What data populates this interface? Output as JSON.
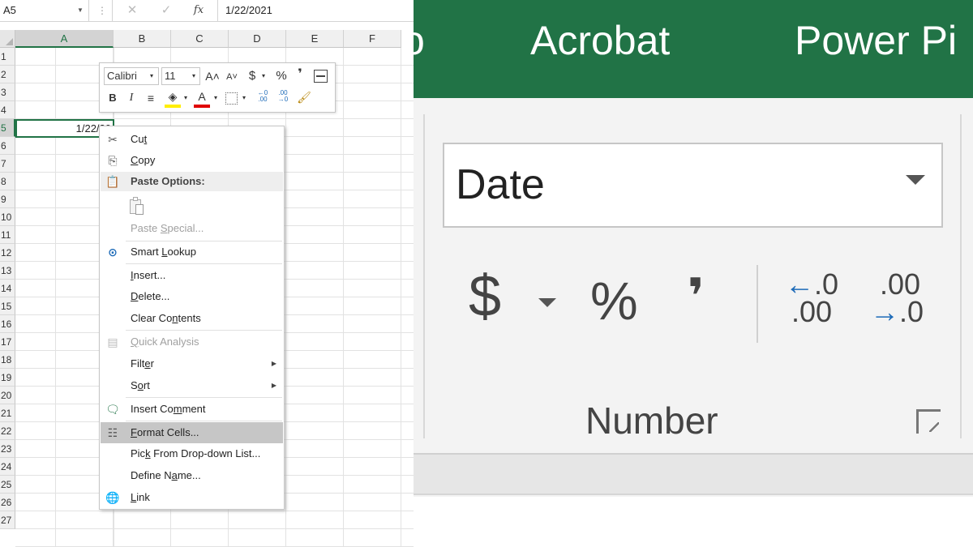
{
  "formula_bar": {
    "name_box": "A5",
    "name_box_arrow": "▼",
    "dots": "⋮",
    "cancel_icon": "✕",
    "enter_icon": "✓",
    "fx_label": "fx",
    "value": "1/22/2021"
  },
  "grid": {
    "columns": [
      "A",
      "B",
      "C",
      "D",
      "E",
      "F"
    ],
    "rows": [
      "1",
      "2",
      "3",
      "4",
      "5",
      "6",
      "7",
      "8",
      "9",
      "10",
      "11",
      "12",
      "13",
      "14",
      "15",
      "16",
      "17",
      "18",
      "19",
      "20",
      "21",
      "22",
      "23",
      "24",
      "25",
      "26",
      "27"
    ],
    "selected_column": "A",
    "selected_row": "5",
    "cell_a5": "1/22/20"
  },
  "mini_toolbar": {
    "font": "Calibri",
    "size": "11",
    "grow_font": "A˄",
    "shrink_font": "A˅",
    "dollar": "$",
    "percent": "%",
    "comma": "❜",
    "bold": "B",
    "italic": "I",
    "align": "≡",
    "fill_icon": "◈",
    "font_color": "A",
    "inc_decimal": "←0\n.00",
    "dec_decimal": ".00\n→0",
    "painter_icon": "🖌",
    "dropdown_arrow": "▾",
    "colors": {
      "fill": "#ffee00",
      "font": "#e00000"
    }
  },
  "context_menu": {
    "cut": {
      "pre": "Cu",
      "key": "t",
      "post": ""
    },
    "copy": {
      "pre": "",
      "key": "C",
      "post": "opy"
    },
    "paste_options": "Paste Options:",
    "paste_special": {
      "pre": "Paste ",
      "key": "S",
      "post": "pecial..."
    },
    "smart_lookup": {
      "pre": "Smart ",
      "key": "L",
      "post": "ookup"
    },
    "insert": {
      "pre": "",
      "key": "I",
      "post": "nsert..."
    },
    "delete": {
      "pre": "",
      "key": "D",
      "post": "elete..."
    },
    "clear_contents": {
      "pre": "Clear Co",
      "key": "n",
      "post": "tents"
    },
    "quick_analysis": {
      "pre": "",
      "key": "Q",
      "post": "uick Analysis"
    },
    "filter": {
      "pre": "Filt",
      "key": "e",
      "post": "r"
    },
    "sort": {
      "pre": "S",
      "key": "o",
      "post": "rt"
    },
    "insert_comment": {
      "pre": "Insert Co",
      "key": "m",
      "post": "ment"
    },
    "format_cells": {
      "pre": "",
      "key": "F",
      "post": "ormat Cells..."
    },
    "pick_from_list": {
      "pre": "Pic",
      "key": "k",
      "post": " From Drop-down List..."
    },
    "define_name": {
      "pre": "Define N",
      "key": "a",
      "post": "me..."
    },
    "link": {
      "pre": "",
      "key": "L",
      "post": "ink"
    },
    "submenu_arrow": "▶"
  },
  "ribbon": {
    "tabs": {
      "partial": "o",
      "acrobat": "Acrobat",
      "power_pivot": "Power Pi"
    },
    "number_format": "Date",
    "currency": "$",
    "percent": "%",
    "comma": "❜",
    "inc_decimal": {
      "top_arrow": "←",
      "top": ".0",
      "bottom": ".00"
    },
    "dec_decimal": {
      "top": ".00",
      "bottom_arrow": "→",
      "bottom": ".0"
    },
    "group_label": "Number",
    "colors": {
      "ribbon_green": "#217346",
      "arrow_blue": "#1e6bb8"
    }
  }
}
